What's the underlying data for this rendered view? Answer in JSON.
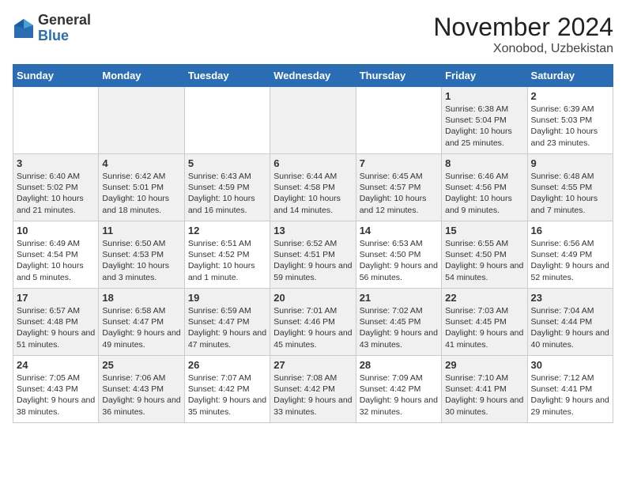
{
  "logo": {
    "general": "General",
    "blue": "Blue"
  },
  "title": "November 2024",
  "subtitle": "Xonobod, Uzbekistan",
  "days_of_week": [
    "Sunday",
    "Monday",
    "Tuesday",
    "Wednesday",
    "Thursday",
    "Friday",
    "Saturday"
  ],
  "weeks": [
    [
      {
        "day": "",
        "info": ""
      },
      {
        "day": "",
        "info": ""
      },
      {
        "day": "",
        "info": ""
      },
      {
        "day": "",
        "info": ""
      },
      {
        "day": "",
        "info": ""
      },
      {
        "day": "1",
        "info": "Sunrise: 6:38 AM\nSunset: 5:04 PM\nDaylight: 10 hours and 25 minutes."
      },
      {
        "day": "2",
        "info": "Sunrise: 6:39 AM\nSunset: 5:03 PM\nDaylight: 10 hours and 23 minutes."
      }
    ],
    [
      {
        "day": "3",
        "info": "Sunrise: 6:40 AM\nSunset: 5:02 PM\nDaylight: 10 hours and 21 minutes."
      },
      {
        "day": "4",
        "info": "Sunrise: 6:42 AM\nSunset: 5:01 PM\nDaylight: 10 hours and 18 minutes."
      },
      {
        "day": "5",
        "info": "Sunrise: 6:43 AM\nSunset: 4:59 PM\nDaylight: 10 hours and 16 minutes."
      },
      {
        "day": "6",
        "info": "Sunrise: 6:44 AM\nSunset: 4:58 PM\nDaylight: 10 hours and 14 minutes."
      },
      {
        "day": "7",
        "info": "Sunrise: 6:45 AM\nSunset: 4:57 PM\nDaylight: 10 hours and 12 minutes."
      },
      {
        "day": "8",
        "info": "Sunrise: 6:46 AM\nSunset: 4:56 PM\nDaylight: 10 hours and 9 minutes."
      },
      {
        "day": "9",
        "info": "Sunrise: 6:48 AM\nSunset: 4:55 PM\nDaylight: 10 hours and 7 minutes."
      }
    ],
    [
      {
        "day": "10",
        "info": "Sunrise: 6:49 AM\nSunset: 4:54 PM\nDaylight: 10 hours and 5 minutes."
      },
      {
        "day": "11",
        "info": "Sunrise: 6:50 AM\nSunset: 4:53 PM\nDaylight: 10 hours and 3 minutes."
      },
      {
        "day": "12",
        "info": "Sunrise: 6:51 AM\nSunset: 4:52 PM\nDaylight: 10 hours and 1 minute."
      },
      {
        "day": "13",
        "info": "Sunrise: 6:52 AM\nSunset: 4:51 PM\nDaylight: 9 hours and 59 minutes."
      },
      {
        "day": "14",
        "info": "Sunrise: 6:53 AM\nSunset: 4:50 PM\nDaylight: 9 hours and 56 minutes."
      },
      {
        "day": "15",
        "info": "Sunrise: 6:55 AM\nSunset: 4:50 PM\nDaylight: 9 hours and 54 minutes."
      },
      {
        "day": "16",
        "info": "Sunrise: 6:56 AM\nSunset: 4:49 PM\nDaylight: 9 hours and 52 minutes."
      }
    ],
    [
      {
        "day": "17",
        "info": "Sunrise: 6:57 AM\nSunset: 4:48 PM\nDaylight: 9 hours and 51 minutes."
      },
      {
        "day": "18",
        "info": "Sunrise: 6:58 AM\nSunset: 4:47 PM\nDaylight: 9 hours and 49 minutes."
      },
      {
        "day": "19",
        "info": "Sunrise: 6:59 AM\nSunset: 4:47 PM\nDaylight: 9 hours and 47 minutes."
      },
      {
        "day": "20",
        "info": "Sunrise: 7:01 AM\nSunset: 4:46 PM\nDaylight: 9 hours and 45 minutes."
      },
      {
        "day": "21",
        "info": "Sunrise: 7:02 AM\nSunset: 4:45 PM\nDaylight: 9 hours and 43 minutes."
      },
      {
        "day": "22",
        "info": "Sunrise: 7:03 AM\nSunset: 4:45 PM\nDaylight: 9 hours and 41 minutes."
      },
      {
        "day": "23",
        "info": "Sunrise: 7:04 AM\nSunset: 4:44 PM\nDaylight: 9 hours and 40 minutes."
      }
    ],
    [
      {
        "day": "24",
        "info": "Sunrise: 7:05 AM\nSunset: 4:43 PM\nDaylight: 9 hours and 38 minutes."
      },
      {
        "day": "25",
        "info": "Sunrise: 7:06 AM\nSunset: 4:43 PM\nDaylight: 9 hours and 36 minutes."
      },
      {
        "day": "26",
        "info": "Sunrise: 7:07 AM\nSunset: 4:42 PM\nDaylight: 9 hours and 35 minutes."
      },
      {
        "day": "27",
        "info": "Sunrise: 7:08 AM\nSunset: 4:42 PM\nDaylight: 9 hours and 33 minutes."
      },
      {
        "day": "28",
        "info": "Sunrise: 7:09 AM\nSunset: 4:42 PM\nDaylight: 9 hours and 32 minutes."
      },
      {
        "day": "29",
        "info": "Sunrise: 7:10 AM\nSunset: 4:41 PM\nDaylight: 9 hours and 30 minutes."
      },
      {
        "day": "30",
        "info": "Sunrise: 7:12 AM\nSunset: 4:41 PM\nDaylight: 9 hours and 29 minutes."
      }
    ]
  ]
}
